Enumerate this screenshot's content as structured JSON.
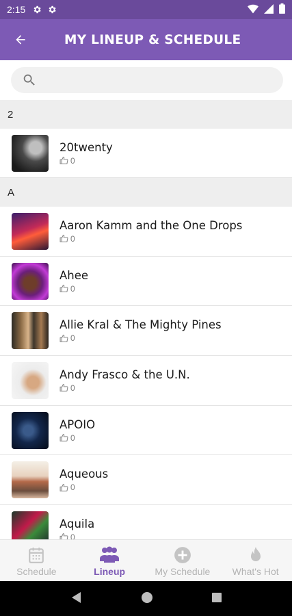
{
  "status_bar": {
    "time": "2:15"
  },
  "header": {
    "title": "MY LINEUP & SCHEDULE"
  },
  "search": {
    "placeholder": ""
  },
  "sections": [
    {
      "letter": "2",
      "artists": [
        {
          "name": "20twenty",
          "likes": "0"
        }
      ]
    },
    {
      "letter": "A",
      "artists": [
        {
          "name": "Aaron Kamm and the One Drops",
          "likes": "0"
        },
        {
          "name": "Ahee",
          "likes": "0"
        },
        {
          "name": "Allie Kral & The Mighty Pines",
          "likes": "0"
        },
        {
          "name": "Andy Frasco & the U.N.",
          "likes": "0"
        },
        {
          "name": "APOIO",
          "likes": "0"
        },
        {
          "name": "Aqueous",
          "likes": "0"
        },
        {
          "name": "Aquila",
          "likes": "0"
        }
      ]
    }
  ],
  "bottom_nav": {
    "items": [
      {
        "label": "Schedule",
        "icon": "calendar-icon",
        "active": false
      },
      {
        "label": "Lineup",
        "icon": "group-icon",
        "active": true
      },
      {
        "label": "My Schedule",
        "icon": "plus-circle-icon",
        "active": false
      },
      {
        "label": "What's Hot",
        "icon": "flame-icon",
        "active": false
      }
    ]
  },
  "colors": {
    "primary": "#7d5ab5",
    "status_bar": "#6a4a9b",
    "inactive": "#b4b4b4"
  }
}
